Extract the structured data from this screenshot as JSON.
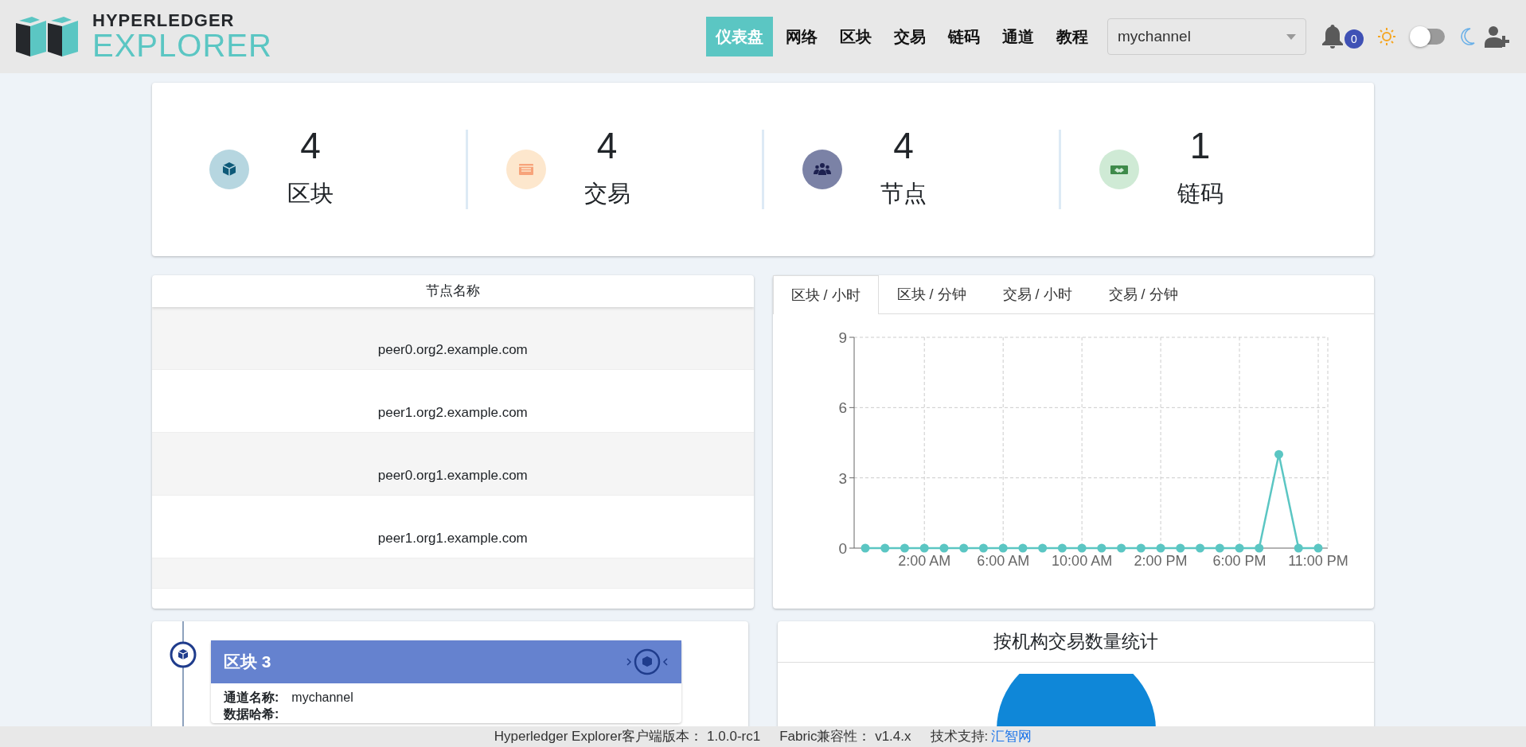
{
  "header": {
    "logo_top": "HYPERLEDGER",
    "logo_bottom": "EXPLORER",
    "nav": [
      {
        "label": "仪表盘",
        "selected": true
      },
      {
        "label": "网络",
        "selected": false
      },
      {
        "label": "区块",
        "selected": false
      },
      {
        "label": "交易",
        "selected": false
      },
      {
        "label": "链码",
        "selected": false
      },
      {
        "label": "通道",
        "selected": false
      },
      {
        "label": "教程",
        "selected": false
      }
    ],
    "channel_select": {
      "value": "mychannel"
    },
    "notifications": {
      "count": "0"
    },
    "dark_mode": {
      "on": false
    }
  },
  "stats": [
    {
      "kind": "blocks",
      "value": "4",
      "label": "区块"
    },
    {
      "kind": "transactions",
      "value": "4",
      "label": "交易"
    },
    {
      "kind": "nodes",
      "value": "4",
      "label": "节点"
    },
    {
      "kind": "chaincodes",
      "value": "1",
      "label": "链码"
    }
  ],
  "peers": {
    "column": "节点名称",
    "rows": [
      "peer0.org2.example.com",
      "peer1.org2.example.com",
      "peer0.org1.example.com",
      "peer1.org1.example.com"
    ]
  },
  "chart_tabs": [
    {
      "label": "区块 / 小时",
      "selected": true
    },
    {
      "label": "区块 / 分钟",
      "selected": false
    },
    {
      "label": "交易 / 小时",
      "selected": false
    },
    {
      "label": "交易 / 分钟",
      "selected": false
    }
  ],
  "chart_data": {
    "type": "line",
    "categories": [
      null,
      null,
      null,
      "2:00 AM",
      null,
      null,
      null,
      "6:00 AM",
      null,
      null,
      null,
      "10:00 AM",
      null,
      null,
      null,
      "2:00 PM",
      null,
      null,
      null,
      "6:00 PM",
      null,
      null,
      null,
      "11:00 PM"
    ],
    "grid": true,
    "series": [
      {
        "color": "#5bc6c3",
        "marker": "circle",
        "values": [
          0,
          0,
          0,
          0,
          0,
          0,
          0,
          0,
          0,
          0,
          0,
          0,
          0,
          0,
          0,
          0,
          0,
          0,
          0,
          0,
          0,
          4,
          0,
          0
        ]
      }
    ],
    "ylim": [
      0,
      9
    ],
    "yticks": [
      0,
      3,
      6,
      9
    ]
  },
  "block_card": {
    "title": "区块 3",
    "fields": [
      {
        "label": "通道名称:",
        "value": "mychannel"
      },
      {
        "label": "数据哈希:"
      }
    ]
  },
  "org_chart": {
    "title": "按机构交易数量统计"
  },
  "footer": {
    "items": [
      {
        "label": "Hyperledger Explorer客户端版本：",
        "value": "1.0.0-rc1"
      },
      {
        "label": "Fabric兼容性：",
        "value": "v1.4.x"
      }
    ],
    "support_label": "技术支持:",
    "support_link": "汇智网"
  }
}
